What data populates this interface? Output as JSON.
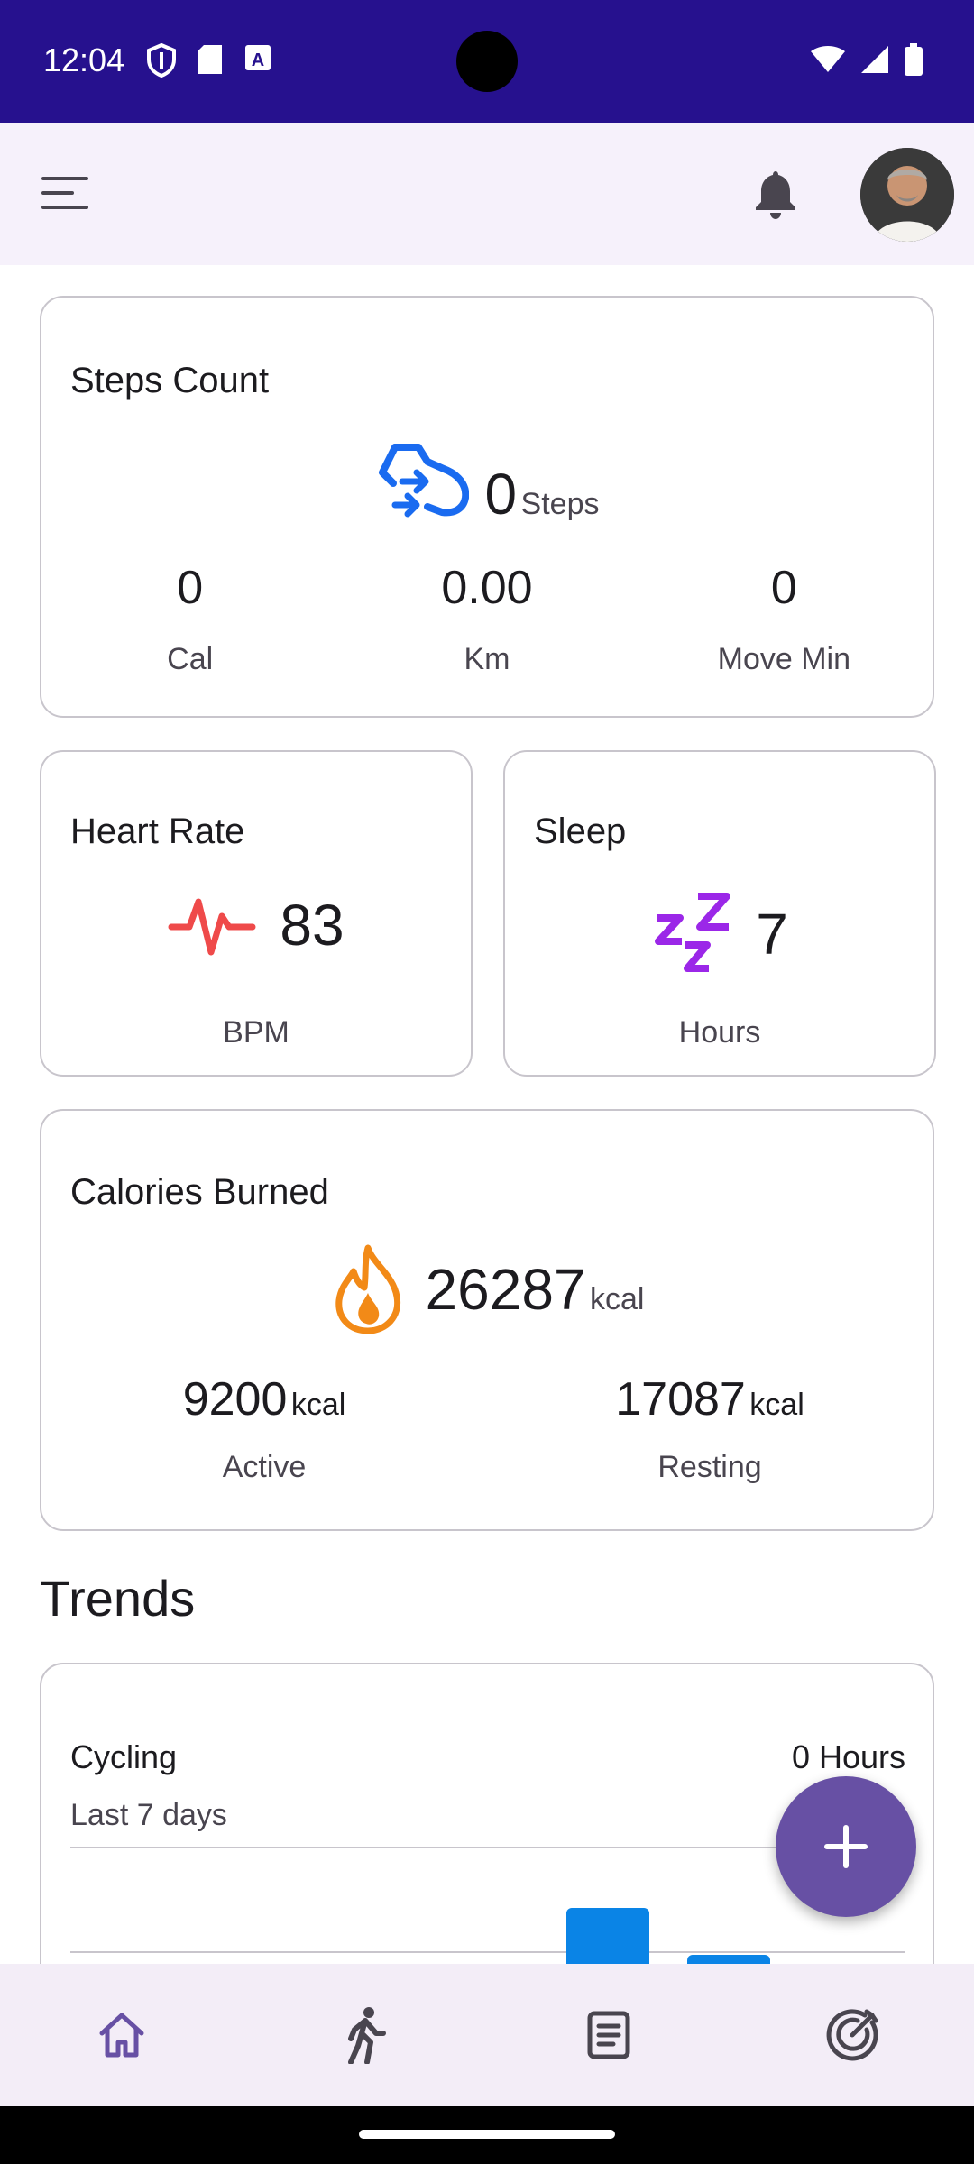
{
  "status_bar": {
    "time": "12:04"
  },
  "steps": {
    "title": "Steps Count",
    "value": "0",
    "unit": "Steps",
    "metrics": [
      {
        "value": "0",
        "label": "Cal"
      },
      {
        "value": "0.00",
        "label": "Km"
      },
      {
        "value": "0",
        "label": "Move Min"
      }
    ]
  },
  "heart_rate": {
    "title": "Heart Rate",
    "value": "83",
    "label": "BPM"
  },
  "sleep": {
    "title": "Sleep",
    "value": "7",
    "label": "Hours"
  },
  "calories": {
    "title": "Calories Burned",
    "value": "26287",
    "unit": "kcal",
    "active": {
      "value": "9200",
      "unit": "kcal",
      "label": "Active"
    },
    "resting": {
      "value": "17087",
      "unit": "kcal",
      "label": "Resting"
    }
  },
  "trends": {
    "title": "Trends",
    "cycling": {
      "title": "Cycling",
      "value": "0 Hours",
      "subtitle": "Last 7 days"
    }
  },
  "colors": {
    "status_bar": "#26118e",
    "accent": "#6750a4",
    "steps_icon": "#1a6bf0",
    "heart_icon": "#ef4a4a",
    "sleep_icon": "#9b27e8",
    "fire_icon": "#f28a17",
    "chart_bar": "#0a84e6"
  },
  "icons": {
    "top_bar": [
      "menu-icon",
      "bell-icon",
      "avatar"
    ],
    "bottom_nav": [
      "home-icon",
      "walk-icon",
      "list-icon",
      "goal-icon"
    ]
  }
}
